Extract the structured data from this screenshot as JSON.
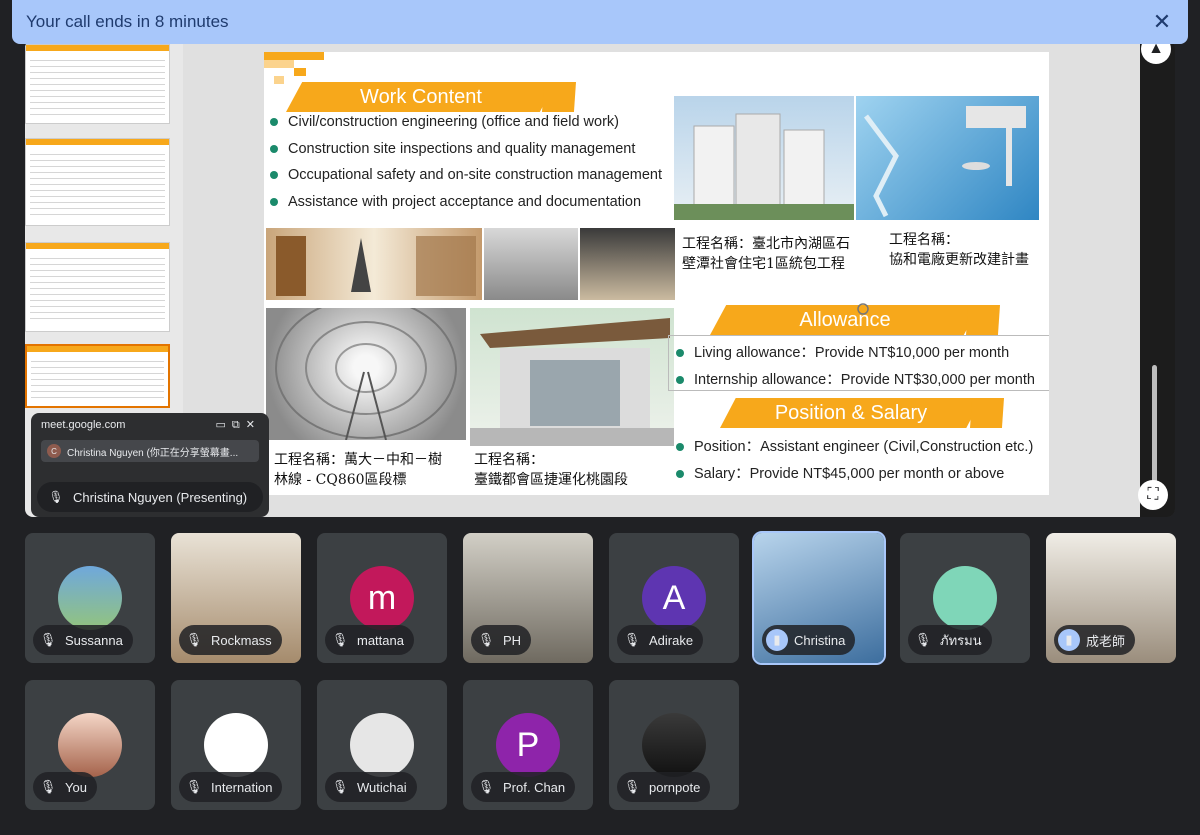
{
  "banner": {
    "text": "Your call ends in 8 minutes",
    "close_icon": "close-icon"
  },
  "slide": {
    "work_content": {
      "title": "Work Content",
      "items": [
        "Civil/construction engineering (office and field work)",
        "Construction site inspections and quality management",
        "Occupational safety and on-site construction management",
        "Assistance with project acceptance and documentation"
      ]
    },
    "captions": {
      "project1_line1": "工程名稱：臺北市內湖區石",
      "project1_line2": "壁潭社會住宅1區統包工程",
      "project2_line1": "工程名稱：",
      "project2_line2": "協和電廠更新改建計畫",
      "project3_line1": "工程名稱：萬大－中和－樹",
      "project3_line2": "林線 - CQ860區段標",
      "project4_line1": "工程名稱：",
      "project4_line2": "臺鐵都會區捷運化桃園段"
    },
    "allowance": {
      "title": "Allowance",
      "items": [
        "Living allowance：Provide NT$10,000 per month",
        "Internship allowance：Provide NT$30,000 per month"
      ]
    },
    "position_salary": {
      "title": "Position & Salary",
      "items": [
        "Position：Assistant engineer (Civil,Construction etc.)",
        "Salary：Provide NT$45,000 per month or above"
      ]
    },
    "accent_color": "#f7a81b",
    "bullet_color": "#1b8a6b"
  },
  "share_popup": {
    "url": "meet.google.com",
    "tab_initial": "C",
    "tab_title": "Christina Nguyen (你正在分享螢幕畫...",
    "presenter": "Christina Nguyen (Presenting)"
  },
  "participants": [
    {
      "name": "Sussanna",
      "mic": "muted"
    },
    {
      "name": "Rockmass",
      "mic": "muted"
    },
    {
      "name": "mattana",
      "mic": "muted",
      "initial": "m",
      "color": "#c2185b"
    },
    {
      "name": "PH",
      "mic": "muted"
    },
    {
      "name": "Adirake",
      "mic": "muted",
      "initial": "A",
      "color": "#5e35b1"
    },
    {
      "name": "Christina",
      "mic": "speaking"
    },
    {
      "name": "ภัทรมน",
      "mic": "muted"
    },
    {
      "name": "成老師",
      "mic": "speaking"
    },
    {
      "name": "You",
      "mic": "muted"
    },
    {
      "name": "Internation",
      "mic": "muted"
    },
    {
      "name": "Wutichai",
      "mic": "muted"
    },
    {
      "name": "Prof. Chan",
      "mic": "muted",
      "initial": "P",
      "color": "#8e24aa"
    },
    {
      "name": "pornpote",
      "mic": "muted"
    }
  ]
}
